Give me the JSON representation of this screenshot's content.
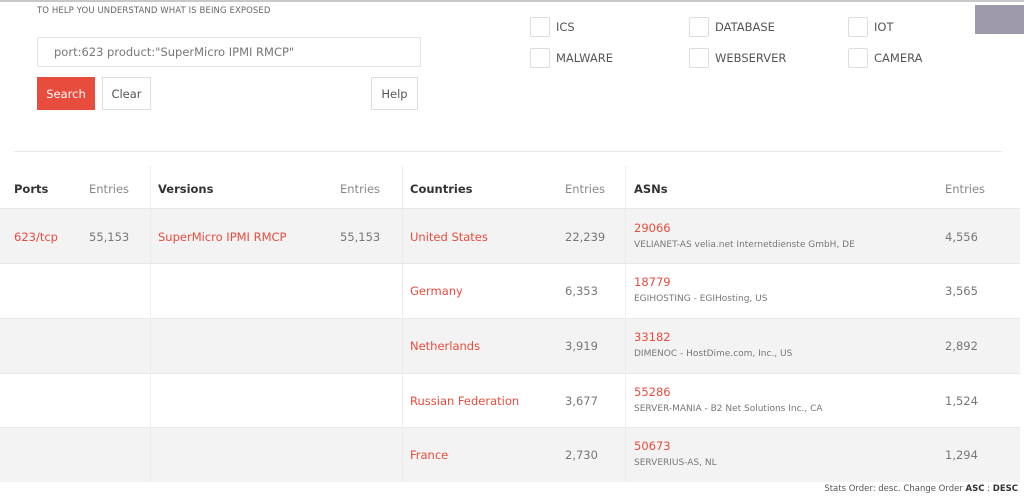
{
  "header": {
    "tagline": "TO HELP YOU UNDERSTAND WHAT IS BEING EXPOSED"
  },
  "search": {
    "value": "port:623 product:\"SuperMicro IPMI RMCP\"",
    "placeholder": "",
    "search_label": "Search",
    "clear_label": "Clear",
    "help_label": "Help"
  },
  "filters": [
    {
      "label": "ICS",
      "checked": false
    },
    {
      "label": "DATABASE",
      "checked": false
    },
    {
      "label": "IOT",
      "checked": false
    },
    {
      "label": "MALWARE",
      "checked": false
    },
    {
      "label": "WEBSERVER",
      "checked": false
    },
    {
      "label": "CAMERA",
      "checked": false
    }
  ],
  "table": {
    "headers": {
      "ports": "Ports",
      "ports_entries": "Entries",
      "versions": "Versions",
      "versions_entries": "Entries",
      "countries": "Countries",
      "countries_entries": "Entries",
      "asns": "ASNs",
      "asns_entries": "Entries"
    },
    "ports": [
      {
        "port": "623/tcp",
        "entries": "55,153"
      }
    ],
    "versions": [
      {
        "version": "SuperMicro IPMI RMCP",
        "entries": "55,153"
      }
    ],
    "countries": [
      {
        "name": "United States",
        "entries": "22,239"
      },
      {
        "name": "Germany",
        "entries": "6,353"
      },
      {
        "name": "Netherlands",
        "entries": "3,919"
      },
      {
        "name": "Russian Federation",
        "entries": "3,677"
      },
      {
        "name": "France",
        "entries": "2,730"
      }
    ],
    "asns": [
      {
        "asn": "29066",
        "desc": "VELIANET-AS velia.net Internetdienste GmbH, DE",
        "entries": "4,556"
      },
      {
        "asn": "18779",
        "desc": "EGIHOSTING - EGIHosting, US",
        "entries": "3,565"
      },
      {
        "asn": "33182",
        "desc": "DIMENOC - HostDime.com, Inc., US",
        "entries": "2,892"
      },
      {
        "asn": "55286",
        "desc": "SERVER-MANIA - B2 Net Solutions Inc., CA",
        "entries": "1,524"
      },
      {
        "asn": "50673",
        "desc": "SERVERIUS-AS, NL",
        "entries": "1,294"
      }
    ]
  },
  "footer": {
    "prefix": "Stats Order: desc. Change Order ",
    "asc_label": "ASC",
    "separator": " : ",
    "desc_label": "DESC"
  },
  "colors": {
    "accent": "#e84c3d",
    "row_alt": "#f3f3f3",
    "corner_box": "#9e9aaa"
  }
}
